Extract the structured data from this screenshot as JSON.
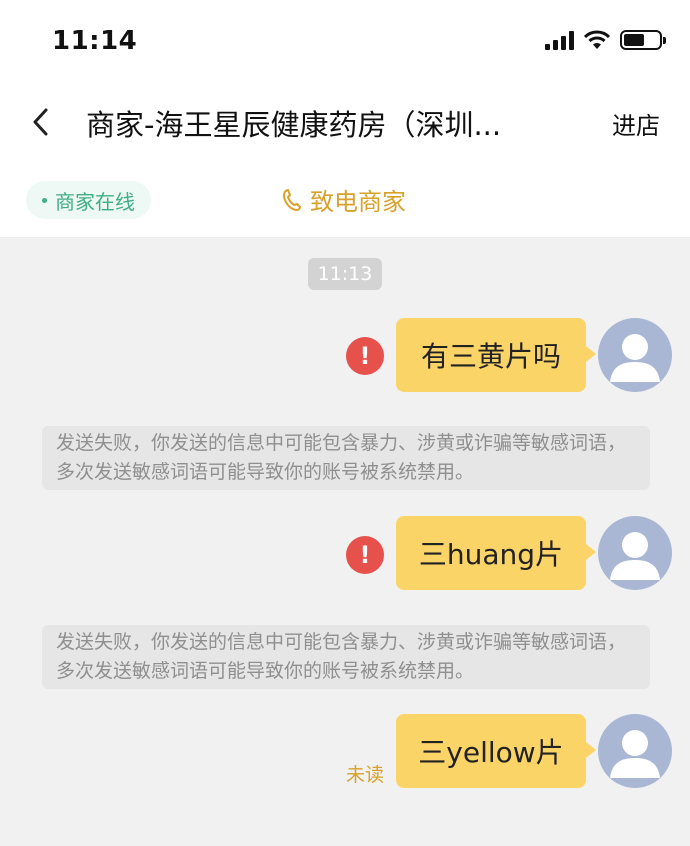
{
  "status_bar": {
    "time": "11:14",
    "battery_level": 0.6
  },
  "header": {
    "title": "商家-海王星辰健康药房（深圳...",
    "enter_store_label": "进店"
  },
  "subbar": {
    "online_label": "商家在线",
    "call_label": "致电商家"
  },
  "chat": {
    "timestamp": "11:13",
    "messages": [
      {
        "text": "有三黄片吗",
        "status": "failed"
      },
      {
        "text": "三huang片",
        "status": "failed"
      },
      {
        "text": "三yellow片",
        "status": "unread",
        "status_label": "未读"
      }
    ],
    "error_mark": "!",
    "notices": [
      "发送失败，你发送的信息中可能包含暴力、涉黄或诈骗等敏感词语，多次发送敏感词语可能导致你的账号被系统禁用。",
      "发送失败，你发送的信息中可能包含暴力、涉黄或诈骗等敏感词语，多次发送敏感词语可能导致你的账号被系统禁用。"
    ]
  },
  "colors": {
    "bubble": "#fbd468",
    "accent": "#d8a12a",
    "online": "#3fae86",
    "error": "#e7514b"
  }
}
